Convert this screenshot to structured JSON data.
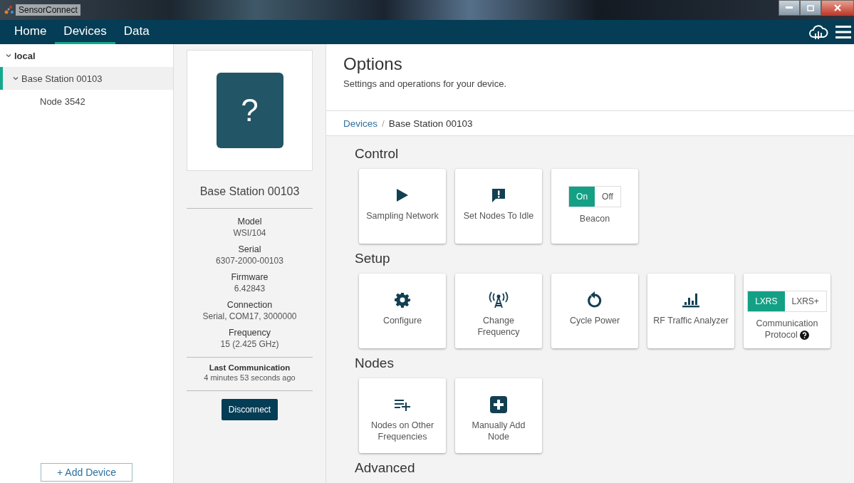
{
  "window": {
    "title": "SensorConnect"
  },
  "nav": {
    "tabs": [
      {
        "label": "Home",
        "selected": false
      },
      {
        "label": "Devices",
        "selected": true
      },
      {
        "label": "Data",
        "selected": false
      }
    ]
  },
  "sidebar": {
    "tree": [
      {
        "label": "local",
        "expanded": true,
        "selected": false,
        "children": [
          {
            "label": "Base Station 00103",
            "expanded": true,
            "selected": true,
            "children": [
              {
                "label": "Node 3542",
                "selected": false
              }
            ]
          }
        ]
      }
    ],
    "add_button": "+ Add Device"
  },
  "device": {
    "name": "Base Station 00103",
    "placeholder_glyph": "?",
    "fields": [
      {
        "label": "Model",
        "value": "WSI/104"
      },
      {
        "label": "Serial",
        "value": "6307-2000-00103"
      },
      {
        "label": "Firmware",
        "value": "6.42843"
      },
      {
        "label": "Connection",
        "value": "Serial, COM17, 3000000"
      },
      {
        "label": "Frequency",
        "value": "15 (2.425 GHz)"
      }
    ],
    "last_communication": {
      "label": "Last Communication",
      "value": "4 minutes 53 seconds ago"
    },
    "disconnect": "Disconnect"
  },
  "options": {
    "title": "Options",
    "subtitle": "Settings and operations for your device.",
    "breadcrumb": {
      "separator": "/",
      "items": [
        {
          "label": "Devices",
          "link": true
        },
        {
          "label": "Base Station 00103",
          "link": false
        }
      ]
    },
    "sections": [
      {
        "title": "Control",
        "tiles": [
          {
            "kind": "action",
            "label": "Sampling Network"
          },
          {
            "kind": "action",
            "label": "Set Nodes To Idle"
          },
          {
            "kind": "toggle",
            "label": "Beacon",
            "options": [
              {
                "label": "On",
                "selected": true
              },
              {
                "label": "Off",
                "selected": false
              }
            ]
          }
        ]
      },
      {
        "title": "Setup",
        "tiles": [
          {
            "kind": "action",
            "label": "Configure"
          },
          {
            "kind": "action",
            "label": "Change Frequency"
          },
          {
            "kind": "action",
            "label": "Cycle Power"
          },
          {
            "kind": "action",
            "label": "RF Traffic Analyzer"
          },
          {
            "kind": "toggle",
            "label": "Communication Protocol",
            "help": true,
            "options": [
              {
                "label": "LXRS",
                "selected": true
              },
              {
                "label": "LXRS+",
                "selected": false
              }
            ]
          }
        ]
      },
      {
        "title": "Nodes",
        "tiles": [
          {
            "kind": "action",
            "label": "Nodes on Other Frequencies"
          },
          {
            "kind": "action",
            "label": "Manually Add Node"
          }
        ]
      },
      {
        "title": "Advanced"
      }
    ]
  }
}
